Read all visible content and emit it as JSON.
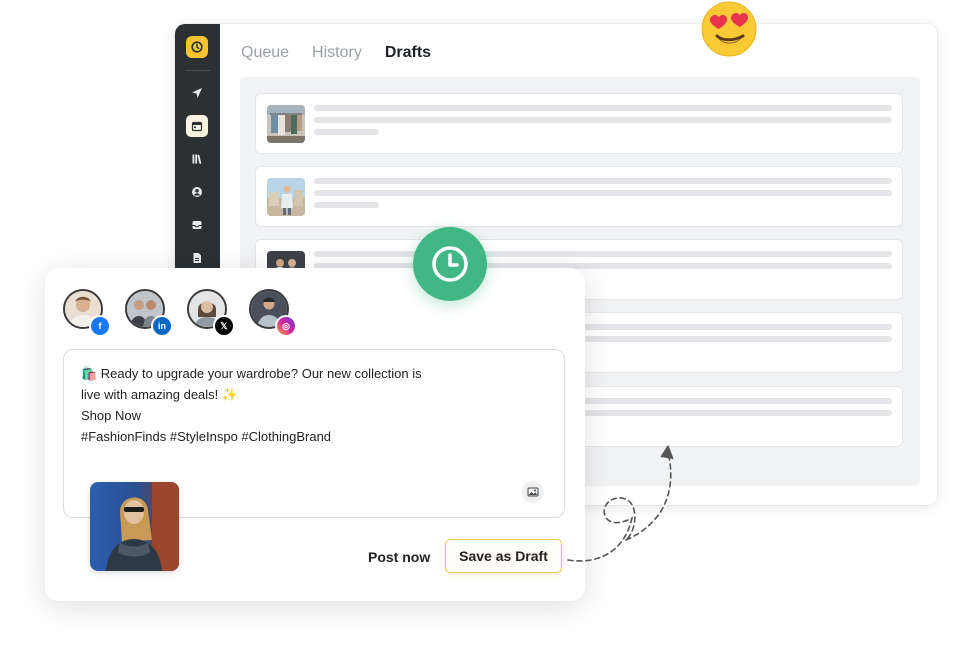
{
  "tabs": {
    "queue": "Queue",
    "history": "History",
    "drafts": "Drafts",
    "active": "Drafts"
  },
  "sidebar": {
    "items": [
      "send-icon",
      "calendar-icon",
      "library-icon",
      "profile-icon",
      "inbox-icon",
      "document-icon"
    ],
    "active_item": "calendar-icon"
  },
  "draft_cards": [
    {
      "thumbnail": "clothing-rack-image"
    },
    {
      "thumbnail": "person-outdoor-image"
    },
    {
      "thumbnail": "couple-image"
    },
    {
      "thumbnail": "placeholder"
    },
    {
      "thumbnail": "placeholder"
    }
  ],
  "composer": {
    "accounts": [
      {
        "network": "facebook",
        "badge": "f"
      },
      {
        "network": "linkedin",
        "badge": "in"
      },
      {
        "network": "x",
        "badge": "𝕏"
      },
      {
        "network": "instagram",
        "badge": "◎"
      }
    ],
    "post_text": {
      "line1": "🛍️ Ready to upgrade your wardrobe? Our new collection is",
      "line2": "live with amazing deals! ✨",
      "line3": "Shop Now",
      "line4": "#FashionFinds #StyleInspo #ClothingBrand"
    },
    "post_now_label": "Post now",
    "save_draft_label": "Save as Draft"
  },
  "colors": {
    "sidebar": "#2b3033",
    "brand_yellow": "#f4c431",
    "clock_green": "#41b883",
    "facebook": "#1877f2",
    "linkedin": "#0a66c2",
    "x": "#000000",
    "instagram": "#d6249f"
  }
}
